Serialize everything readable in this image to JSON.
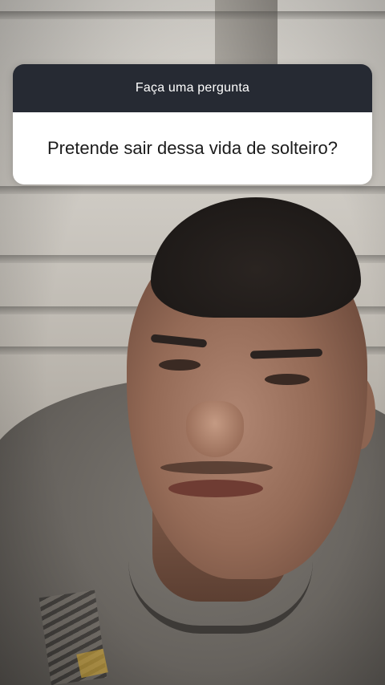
{
  "question_sticker": {
    "header": "Faça uma pergunta",
    "question": "Pretende sair dessa vida de solteiro?",
    "header_color": "#262a33",
    "body_color": "#ffffff"
  },
  "story": {
    "background_description_icon": "story-photo"
  }
}
